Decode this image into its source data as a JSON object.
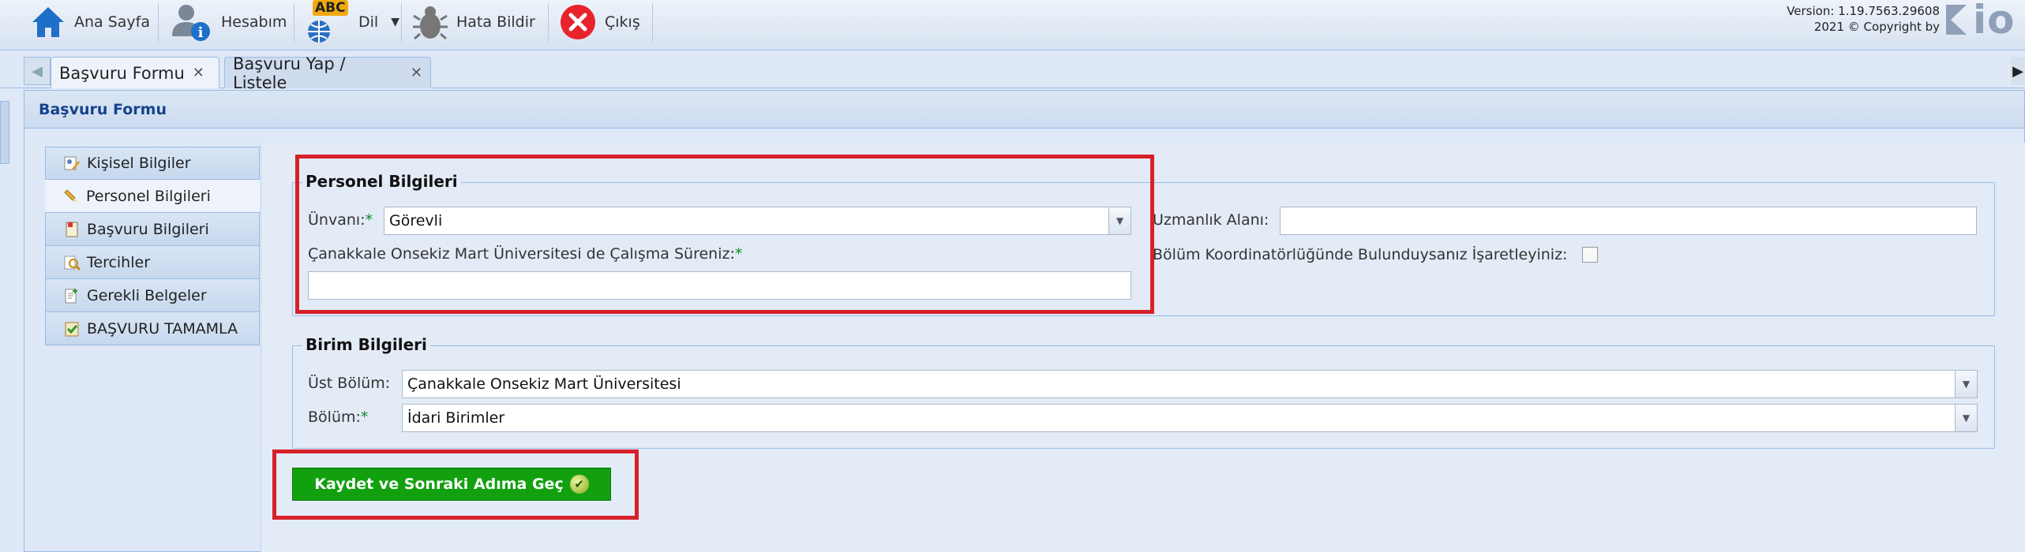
{
  "toolbar": {
    "home_label": "Ana Sayfa",
    "account_label": "Hesabım",
    "language_badge": "ABC",
    "language_label": "Dil",
    "bug_label": "Hata Bildir",
    "exit_label": "Çıkış",
    "version_line1": "Version: 1.19.7563.29608",
    "version_line2": "2021 © Copyright by",
    "logo_text": "io"
  },
  "tabs": [
    {
      "label": "Başvuru Formu",
      "active": true
    },
    {
      "label": "Başvuru Yap / Listele",
      "active": false
    }
  ],
  "panel": {
    "title": "Başvuru Formu"
  },
  "nav": {
    "items": [
      {
        "label": "Kişisel Bilgiler",
        "icon": "user-edit-icon"
      },
      {
        "label": "Personel Bilgileri",
        "icon": "pencil-icon"
      },
      {
        "label": "Başvuru Bilgileri",
        "icon": "document-icon"
      },
      {
        "label": "Tercihler",
        "icon": "search-list-icon"
      },
      {
        "label": "Gerekli Belgeler",
        "icon": "document-add-icon"
      },
      {
        "label": "BAŞVURU TAMAMLA",
        "icon": "check-clipboard-icon"
      }
    ]
  },
  "personel": {
    "legend": "Personel Bilgileri",
    "unvan_label": "Ünvanı:",
    "unvan_value": "Görevli",
    "sure_label": "Çanakkale Onsekiz Mart Üniversitesi de Çalışma Süreniz:",
    "sure_value": "",
    "uzmanlik_label": "Uzmanlık Alanı:",
    "uzmanlik_value": "",
    "koordinator_label": "Bölüm Koordinatörlüğünde Bulunduysanız İşaretleyiniz:",
    "required_mark": "*"
  },
  "birim": {
    "legend": "Birim Bilgileri",
    "ust_bolum_label": "Üst Bölüm:",
    "ust_bolum_value": "Çanakkale Onsekiz Mart Üniversitesi",
    "bolum_label": "Bölüm:",
    "bolum_value": "İdari Birimler"
  },
  "actions": {
    "submit_label": "Kaydet ve Sonraki Adıma Geç"
  },
  "colors": {
    "highlight": "#d8202a",
    "submit": "#13a00f",
    "accent": "#15428b"
  }
}
